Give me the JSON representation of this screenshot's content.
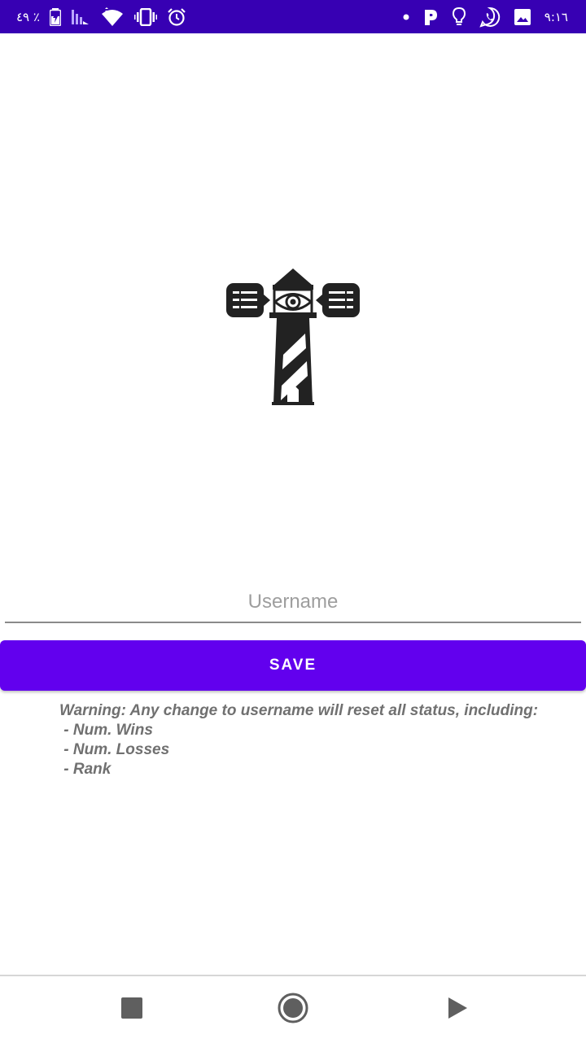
{
  "status_bar": {
    "battery_percent": "٤٩ ٪",
    "time": "٩:١٦",
    "background": "#3700b3",
    "left_icons": [
      "battery-charging-icon",
      "signal-icon",
      "wifi-icon",
      "vibrate-icon",
      "alarm-icon"
    ],
    "right_icons": [
      "notification-dot-icon",
      "parking-app-icon",
      "lightbulb-icon",
      "whatsapp-icon",
      "image-icon"
    ]
  },
  "form": {
    "username_placeholder": "Username",
    "username_value": "",
    "save_label": "SAVE",
    "accent": "#6200ee"
  },
  "warning": {
    "heading": "Warning: Any change to username will reset all status, including:",
    "items": [
      " - Num. Wins",
      " - Num. Losses",
      " - Rank"
    ],
    "color": "#707070"
  },
  "nav_bar": {
    "icons": [
      "recents-square-icon",
      "home-circle-icon",
      "back-triangle-icon"
    ]
  },
  "logo": {
    "icon": "lighthouse-logo-icon"
  }
}
